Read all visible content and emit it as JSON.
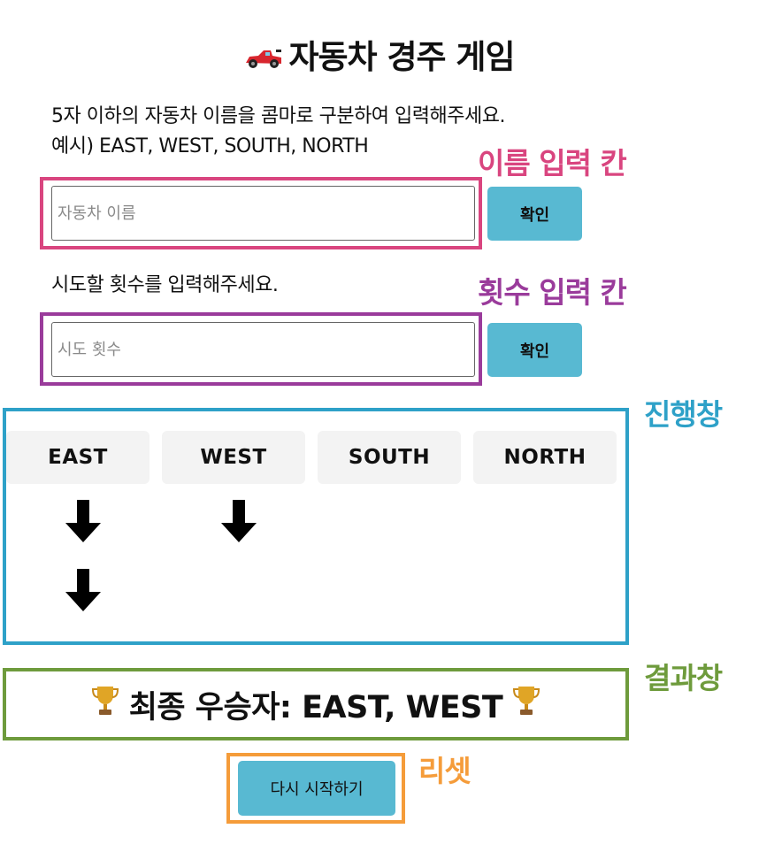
{
  "title": "자동차 경주 게임",
  "icons": {
    "title_icon": "race-car-icon",
    "progress_marker": "down-arrow-icon",
    "result_icon": "trophy-icon"
  },
  "colors": {
    "button": "#58b9d2",
    "annotation_name": "#d9457f",
    "annotation_count": "#9a3b9b",
    "annotation_progress": "#2ea1c8",
    "annotation_result": "#6e9b3c",
    "annotation_reset": "#f59c3a"
  },
  "name_section": {
    "instruction_line1": "5자 이하의 자동차 이름을 콤마로 구분하여 입력해주세요.",
    "instruction_line2": "예시) EAST, WEST, SOUTH, NORTH",
    "placeholder": "자동차 이름",
    "value": "",
    "button_label": "확인"
  },
  "count_section": {
    "instruction": "시도할 횟수를 입력해주세요.",
    "placeholder": "시도 횟수",
    "value": "",
    "button_label": "확인"
  },
  "annotations": {
    "name_input": "이름 입력 칸",
    "count_input": "횟수 입력 칸",
    "progress": "진행창",
    "result": "결과창",
    "reset": "리셋"
  },
  "progress": {
    "cars": [
      {
        "name": "EAST",
        "steps": 2
      },
      {
        "name": "WEST",
        "steps": 1
      },
      {
        "name": "SOUTH",
        "steps": 0
      },
      {
        "name": "NORTH",
        "steps": 0
      }
    ]
  },
  "result": {
    "text": "최종 우승자: EAST, WEST"
  },
  "reset": {
    "button_label": "다시 시작하기"
  }
}
